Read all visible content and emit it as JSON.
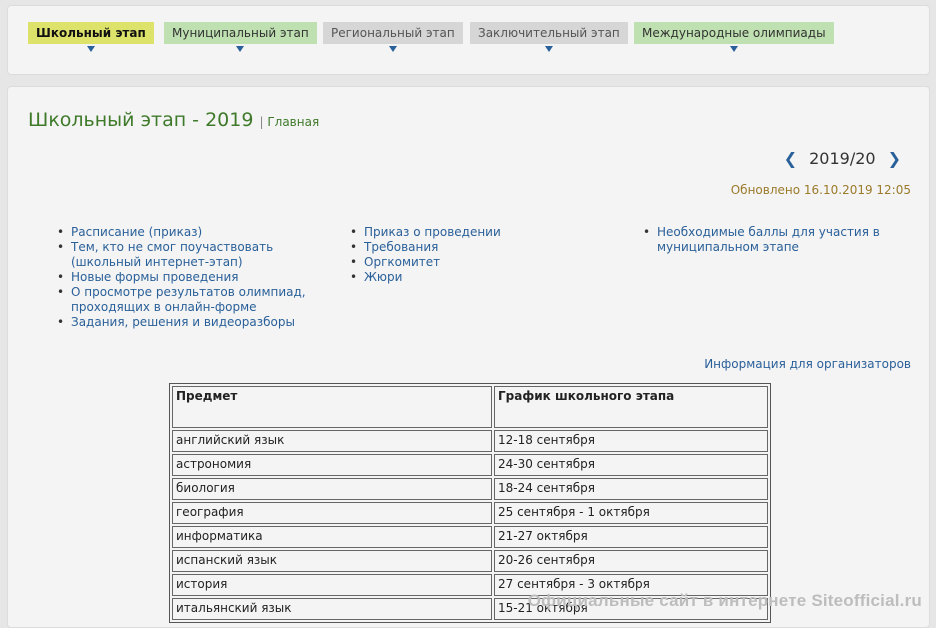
{
  "tabs": [
    {
      "label": "Школьный этап"
    },
    {
      "label": "Муниципальный этап"
    },
    {
      "label": "Региональный этап"
    },
    {
      "label": "Заключительный этап"
    },
    {
      "label": "Международные олимпиады"
    }
  ],
  "header": {
    "title": "Школьный этап - 2019",
    "separator": "|",
    "breadcrumb": "Главная"
  },
  "year_nav": {
    "year": "2019/20",
    "prev_icon": "chevron-left-icon",
    "next_icon": "chevron-right-icon"
  },
  "updated": "Обновлено 16.10.2019 12:05",
  "links": {
    "col1": [
      "Расписание (приказ)",
      "Тем, кто не смог поучаствовать (школьный интернет-этап)",
      "Новые формы проведения",
      "О просмотре результатов олимпиад, проходящих в онлайн-форме",
      "Задания, решения и видеоразборы"
    ],
    "col2": [
      "Приказ о проведении",
      "Требования",
      "Оргкомитет",
      "Жюри"
    ],
    "col3": [
      "Необходимые баллы для участия в муниципальном этапе"
    ]
  },
  "info_link": "Информация для организаторов",
  "table": {
    "headers": [
      "Предмет",
      "График школьного этапа"
    ],
    "rows": [
      [
        "английский язык",
        "12-18 сентября"
      ],
      [
        "астрономия",
        "24-30 сентября"
      ],
      [
        "биология",
        "18-24 сентября"
      ],
      [
        "география",
        "25 сентября - 1 октября"
      ],
      [
        "информатика",
        "21-27 октября"
      ],
      [
        "испанский язык",
        "20-26 сентября"
      ],
      [
        "история",
        "27 сентября - 3 октября"
      ],
      [
        "итальянский язык",
        "15-21 октября"
      ]
    ]
  },
  "watermark": "Официальные сайт в интернете Siteofficial.ru",
  "colors": {
    "accent_green": "#3f7a2a",
    "link_blue": "#2a6099",
    "active_tab": "#dde36a"
  }
}
